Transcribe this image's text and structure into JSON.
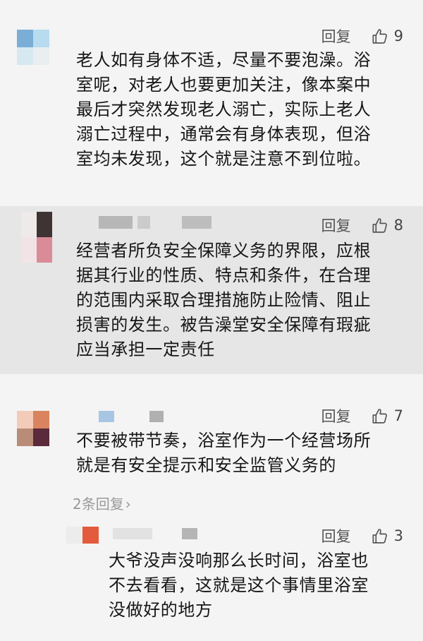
{
  "comments": [
    {
      "reply_label": "回复",
      "like_icon": "thumbs-up-icon",
      "likes": "9",
      "lines": [
        "老人如有身体不适，尽量不要泡澡。浴",
        "室呢，对老人也要更加关注，像本案中",
        "最后才突然发现老人溺亡，实际上老人",
        "溺亡过程中，通常会有身体表现，但浴",
        "室均未发现，这个就是注意不到位啦。"
      ]
    },
    {
      "reply_label": "回复",
      "like_icon": "thumbs-up-icon",
      "likes": "8",
      "lines": [
        "经营者所负安全保障义务的界限，应根",
        "据其行业的性质、特点和条件，在合理",
        "的范围内采取合理措施防止险情、阻止",
        "损害的发生。被告澡堂安全保障有瑕疵",
        "应当承担一定责任"
      ]
    },
    {
      "reply_label": "回复",
      "like_icon": "thumbs-up-icon",
      "likes": "7",
      "lines": [
        "不要被带节奏，浴室作为一个经营场所",
        "就是有安全提示和安全监管义务的"
      ],
      "replies_link": "2条回复",
      "replies_chevron": "›",
      "reply": {
        "reply_label": "回复",
        "like_icon": "thumbs-up-icon",
        "likes": "3",
        "lines": [
          "大爷没声没响那么长时间，浴室也",
          "不去看看，这就是这个事情里浴室",
          "没做好的地方"
        ]
      }
    }
  ],
  "colors": {
    "background": "#f4f4f4",
    "highlight_background": "#e6e6e6",
    "action_text": "#555555",
    "link_gray": "#999999",
    "body_text": "#161616"
  }
}
